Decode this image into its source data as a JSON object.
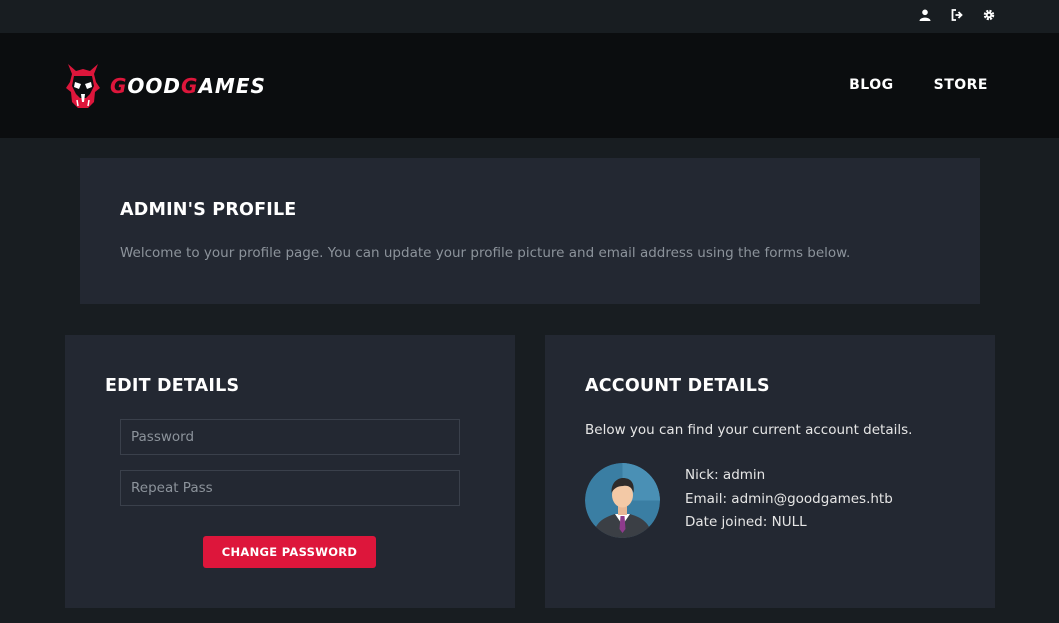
{
  "topbar": {
    "icons": [
      "user-icon",
      "sign-out-icon",
      "gear-icon"
    ]
  },
  "header": {
    "logo_text_first": "G",
    "logo_text_mid": "OOD",
    "logo_text_g2": "G",
    "logo_text_end": "AMES",
    "nav": {
      "blog": "BLOG",
      "store": "STORE"
    }
  },
  "profile": {
    "title": "ADMIN'S PROFILE",
    "description": "Welcome to your profile page. You can update your profile picture and email address using the forms below."
  },
  "edit": {
    "title": "EDIT DETAILS",
    "password_placeholder": "Password",
    "repeat_placeholder": "Repeat Pass",
    "button_label": "CHANGE PASSWORD"
  },
  "account": {
    "title": "ACCOUNT DETAILS",
    "description": "Below you can find your current account details.",
    "nick": "Nick: admin",
    "email": "Email: admin@goodgames.htb",
    "date_joined": "Date joined: NULL"
  },
  "colors": {
    "accent": "#dd163b",
    "panel": "#232832",
    "background": "#181d21",
    "header": "#0b0d0f"
  }
}
